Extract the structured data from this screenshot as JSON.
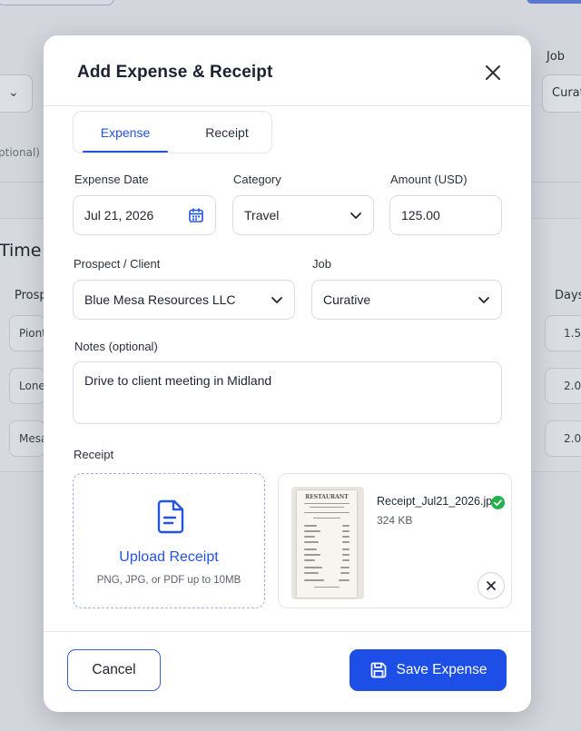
{
  "background": {
    "job_label": "Job",
    "job_value": "Curat",
    "optional_text": "ptional)",
    "section_title": "Time",
    "col_prospect": "Prosp",
    "col_days": "Days",
    "rows": [
      {
        "prospect": "Piont",
        "days": "1.5"
      },
      {
        "prospect": "Lone",
        "days": "2.0"
      },
      {
        "prospect": "Mesa",
        "days": "2.0"
      }
    ]
  },
  "modal": {
    "title": "Add Expense & Receipt",
    "close_icon": "close-icon",
    "tabs": [
      {
        "label": "Expense",
        "active": true
      },
      {
        "label": "Receipt",
        "active": false
      }
    ],
    "expense_date": {
      "label": "Expense Date",
      "value": "Jul 21, 2026",
      "icon": "calendar-icon"
    },
    "category": {
      "label": "Category",
      "value": "Travel",
      "icon": "chevron-down-icon"
    },
    "amount": {
      "label": "Amount (USD)",
      "value": "125.00"
    },
    "prospect": {
      "label": "Prospect / Client",
      "value": "Blue Mesa Resources LLC"
    },
    "job": {
      "label": "Job",
      "value": "Curative"
    },
    "notes": {
      "label": "Notes (optional)",
      "value": "Drive to client meeting in Midland"
    },
    "receipt": {
      "label": "Receipt",
      "upload_title": "Upload Receipt",
      "upload_hint": "PNG, JPG, or PDF up to 10MB",
      "upload_icon": "document-icon",
      "file_name": "Receipt_Jul21_2026.jpg",
      "file_size": "324 KB",
      "status_icon": "check-circle-icon",
      "thumbnail_title": "RESTAURANT"
    },
    "footer": {
      "cancel_label": "Cancel",
      "save_label": "Save Expense",
      "save_icon": "save-icon"
    }
  },
  "colors": {
    "accent": "#1d4fe6",
    "tab_active": "#2454e0",
    "success": "#22b14c",
    "overlay": "#d3d6dc"
  }
}
